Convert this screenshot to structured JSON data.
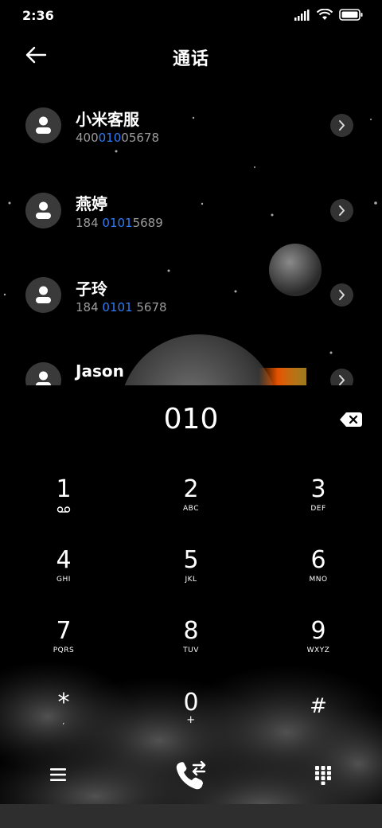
{
  "status": {
    "time": "2:36"
  },
  "header": {
    "title": "通话"
  },
  "contacts": [
    {
      "name": "小米客服",
      "num_pre": "400",
      "num_hl": "010",
      "num_post": "05678"
    },
    {
      "name": "燕婷",
      "num_pre": "184 ",
      "num_hl": "0101",
      "num_post": "5689"
    },
    {
      "name": "子玲",
      "num_pre": "184 ",
      "num_hl": "0101",
      "num_post": " 5678"
    },
    {
      "name": "Jason",
      "num_pre": "",
      "num_hl": "",
      "num_post": ""
    }
  ],
  "dial": {
    "value": "010"
  },
  "keys": [
    {
      "digit": "1",
      "sub": ""
    },
    {
      "digit": "2",
      "sub": "ABC"
    },
    {
      "digit": "3",
      "sub": "DEF"
    },
    {
      "digit": "4",
      "sub": "GHI"
    },
    {
      "digit": "5",
      "sub": "JKL"
    },
    {
      "digit": "6",
      "sub": "MNO"
    },
    {
      "digit": "7",
      "sub": "PQRS"
    },
    {
      "digit": "8",
      "sub": "TUV"
    },
    {
      "digit": "9",
      "sub": "WXYZ"
    },
    {
      "digit": "*",
      "sub": ","
    },
    {
      "digit": "0",
      "sub": "+"
    },
    {
      "digit": "#",
      "sub": ""
    }
  ],
  "icons": {
    "signal": "signal-icon",
    "wifi": "wifi-icon",
    "battery": "battery-icon",
    "back": "back-arrow-icon",
    "delete": "backspace-icon",
    "voicemail": "voicemail-icon",
    "menu": "menu-icon",
    "call": "call-icon",
    "keypad": "keypad-icon"
  },
  "colors": {
    "highlight": "#2f7cf6",
    "background": "#000000"
  }
}
